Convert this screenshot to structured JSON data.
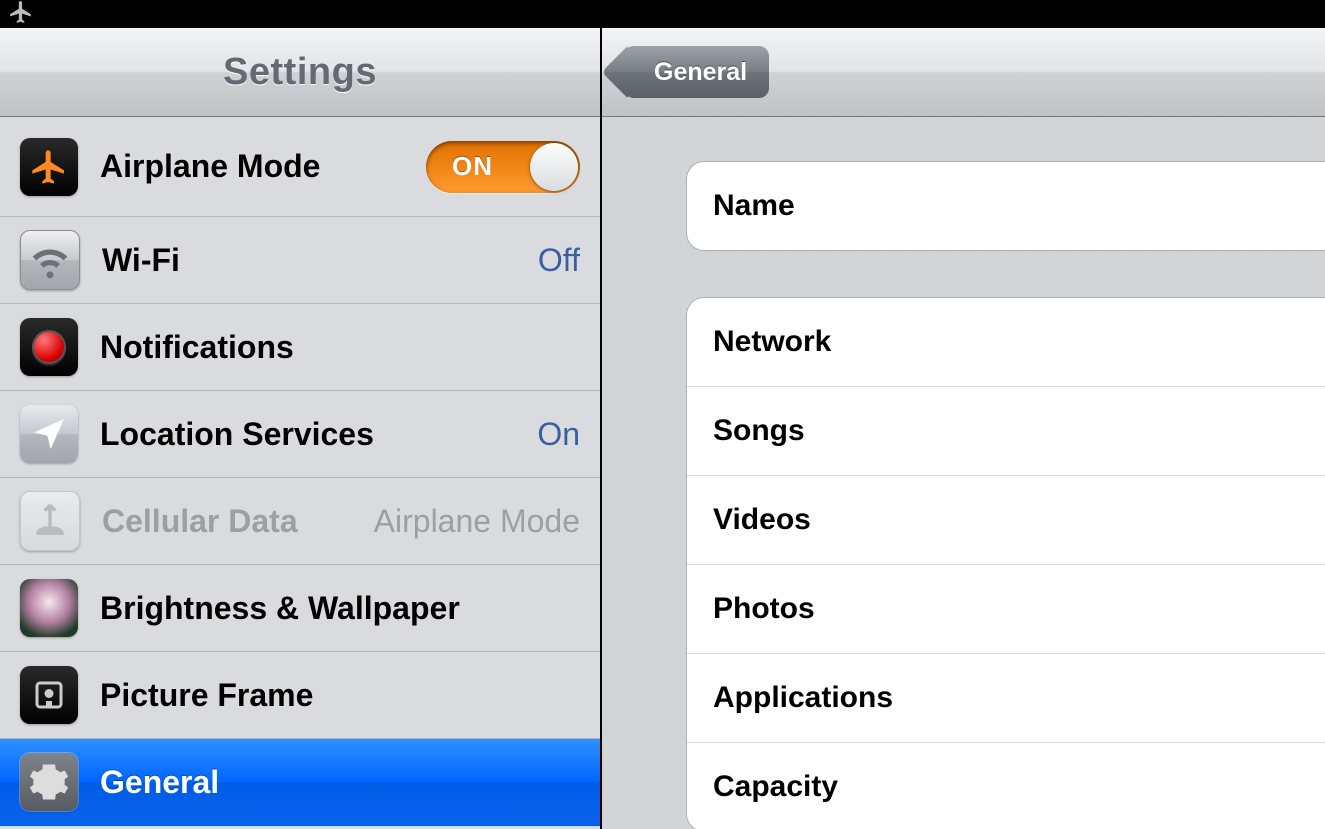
{
  "sidebar": {
    "title": "Settings",
    "items": [
      {
        "label": "Airplane Mode",
        "toggle_on_text": "ON",
        "selected": false,
        "disabled": false,
        "kind": "toggle"
      },
      {
        "label": "Wi-Fi",
        "value": "Off",
        "selected": false,
        "disabled": false,
        "kind": "value"
      },
      {
        "label": "Notifications",
        "selected": false,
        "disabled": false,
        "kind": "plain"
      },
      {
        "label": "Location Services",
        "value": "On",
        "selected": false,
        "disabled": false,
        "kind": "value"
      },
      {
        "label": "Cellular Data",
        "value": "Airplane Mode",
        "selected": false,
        "disabled": true,
        "kind": "value"
      },
      {
        "label": "Brightness & Wallpaper",
        "selected": false,
        "disabled": false,
        "kind": "plain"
      },
      {
        "label": "Picture Frame",
        "selected": false,
        "disabled": false,
        "kind": "plain"
      },
      {
        "label": "General",
        "selected": true,
        "disabled": false,
        "kind": "plain"
      }
    ]
  },
  "detail": {
    "back_label": "General",
    "groups": [
      {
        "cells": [
          "Name"
        ]
      },
      {
        "cells": [
          "Network",
          "Songs",
          "Videos",
          "Photos",
          "Applications",
          "Capacity"
        ]
      }
    ]
  }
}
